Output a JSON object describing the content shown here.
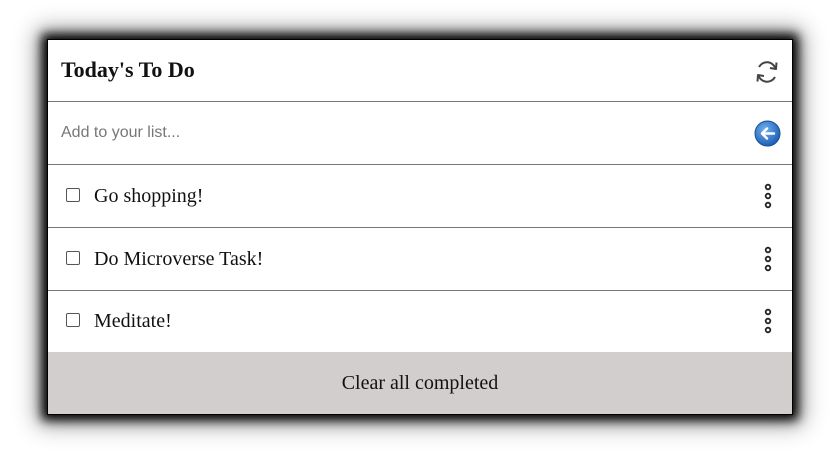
{
  "header": {
    "title": "Today's To Do",
    "refresh_icon": "refresh-icon"
  },
  "add": {
    "placeholder": "Add to your list...",
    "value": "",
    "submit_icon": "arrow-left-circle-icon"
  },
  "items": [
    {
      "label": "Go shopping!",
      "checked": false
    },
    {
      "label": "Do Microverse Task!",
      "checked": false
    },
    {
      "label": "Meditate!",
      "checked": false
    }
  ],
  "footer": {
    "clear_label": "Clear all completed"
  },
  "colors": {
    "footer_bg": "#d3cece",
    "accent_blue": "#2a6fc9"
  }
}
